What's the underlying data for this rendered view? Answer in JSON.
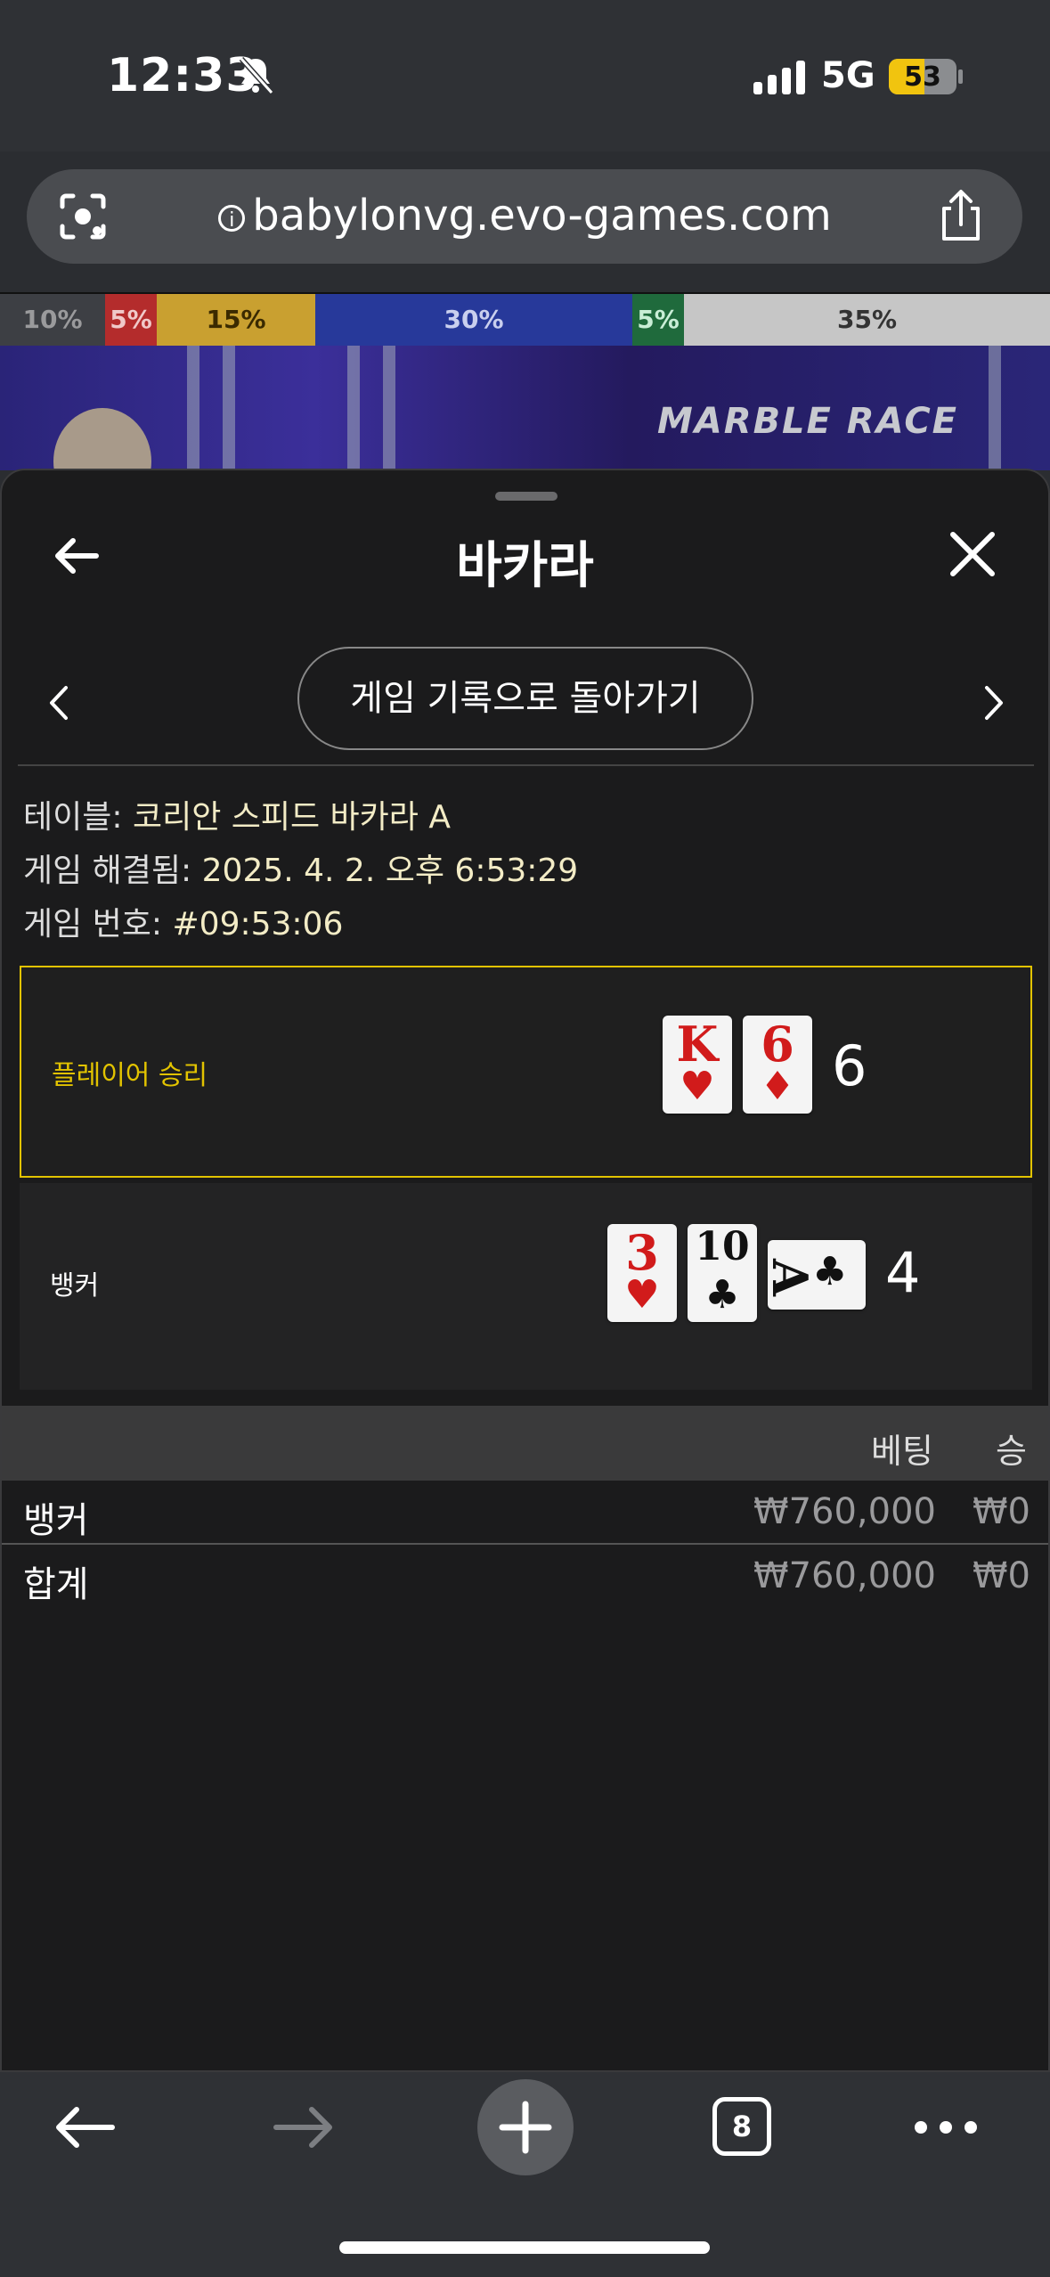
{
  "status": {
    "time": "12:33",
    "network": "5G",
    "battery": "53",
    "battery_level": 0.53
  },
  "browser": {
    "url": "babylonvg.evo-games.com",
    "tabs_count": "8"
  },
  "odds_strip": [
    {
      "label": "10%",
      "color": "#3d3f44",
      "text": "#9a9a9c"
    },
    {
      "label": "5%",
      "color": "#b42c2c",
      "text": "#f0c9c9"
    },
    {
      "label": "15%",
      "color": "#c9a030",
      "text": "#3a2a00"
    },
    {
      "label": "30%",
      "color": "#27399a",
      "text": "#c9cfee"
    },
    {
      "label": "5%",
      "color": "#1f6a3c",
      "text": "#c9eed6"
    },
    {
      "label": "35%",
      "color": "#c6c6c6",
      "text": "#333333"
    }
  ],
  "video": {
    "logo_text": "MARBLE RACE"
  },
  "sheet": {
    "title": "바카라",
    "back_to_history": "게임 기록으로 돌아가기",
    "table_label": "테이블:",
    "table_value": "코리안 스피드 바카라 A",
    "resolved_label": "게임 해결됨:",
    "resolved_value": "2025. 4. 2. 오후 6:53:29",
    "game_no_label": "게임 번호:",
    "game_no_value": "#09:53:06"
  },
  "hands": {
    "player": {
      "label": "플레이어 승리",
      "score": "6",
      "cards": [
        {
          "rank": "K",
          "suit": "♥",
          "color": "#d11b1b"
        },
        {
          "rank": "6",
          "suit": "♦",
          "color": "#d11b1b"
        }
      ]
    },
    "banker": {
      "label": "뱅커",
      "score": "4",
      "cards": [
        {
          "rank": "3",
          "suit": "♥",
          "color": "#d11b1b"
        },
        {
          "rank": "10",
          "suit": "♣",
          "color": "#111111"
        },
        {
          "rank": "A",
          "suit": "♣",
          "color": "#111111"
        }
      ]
    }
  },
  "bets_table": {
    "headers": {
      "bet": "베팅",
      "win": "승"
    },
    "rows": [
      {
        "label": "뱅커",
        "bet": "₩760,000",
        "win": "₩0"
      }
    ],
    "total": {
      "label": "합계",
      "bet": "₩760,000",
      "win": "₩0"
    }
  },
  "colors": {
    "accent": "#e2c300",
    "sheet_bg": "#1b1b1c"
  }
}
